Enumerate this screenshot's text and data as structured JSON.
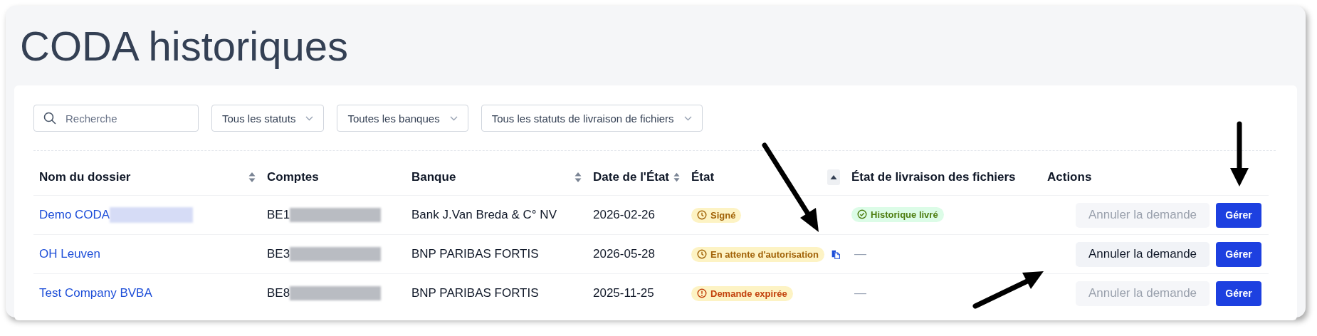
{
  "page": {
    "title": "CODA historiques"
  },
  "filters": {
    "search": {
      "placeholder": "Recherche"
    },
    "dropdowns": [
      {
        "label": "Tous les statuts"
      },
      {
        "label": "Toutes les banques"
      },
      {
        "label": "Tous les statuts de livraison de fichiers"
      }
    ]
  },
  "table": {
    "columns": [
      {
        "label": "Nom du dossier",
        "sortable": true
      },
      {
        "label": "Comptes",
        "sortable": false
      },
      {
        "label": "Banque",
        "sortable": true
      },
      {
        "label": "Date de l'État",
        "sortable": true
      },
      {
        "label": "État",
        "sortable": true,
        "sorted_ascending": true
      },
      {
        "label": "État de livraison des fichiers",
        "sortable": false
      },
      {
        "label": "Actions",
        "sortable": false
      }
    ],
    "rows": [
      {
        "name": "Demo CODA",
        "redacted_name": true,
        "account": "BE1",
        "bank": "Bank J.Van Breda & C° NV",
        "date": "2026-02-26",
        "status": {
          "kind": "signed",
          "label": "Signé"
        },
        "copy_icon": false,
        "delivery": {
          "kind": "delivered",
          "label": "Historique livré"
        },
        "cancel": {
          "label": "Annuler la demande",
          "disabled": true
        },
        "manage": "Gérer"
      },
      {
        "name": "OH Leuven",
        "redacted_name": false,
        "account": "BE3",
        "bank": "BNP PARIBAS FORTIS",
        "date": "2026-05-28",
        "status": {
          "kind": "pending",
          "label": "En attente d'autorisation"
        },
        "copy_icon": true,
        "delivery": {
          "kind": "none",
          "label": "—"
        },
        "cancel": {
          "label": "Annuler la demande",
          "disabled": false
        },
        "manage": "Gérer"
      },
      {
        "name": "Test Company BVBA",
        "redacted_name": false,
        "account": "BE8",
        "bank": "BNP PARIBAS FORTIS",
        "date": "2025-11-25",
        "status": {
          "kind": "expired",
          "label": "Demande expirée"
        },
        "copy_icon": false,
        "delivery": {
          "kind": "none",
          "label": "—"
        },
        "cancel": {
          "label": "Annuler la demande",
          "disabled": true
        },
        "manage": "Gérer"
      }
    ]
  }
}
